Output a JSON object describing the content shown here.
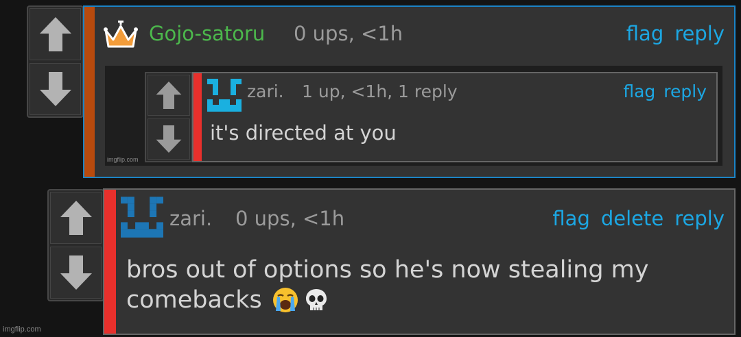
{
  "comment1": {
    "username": "Gojo-satoru",
    "meta": "0 ups, <1h",
    "actions": [
      "flag",
      "reply"
    ],
    "username_color": "#4cb84c",
    "bar_color": "#b84a0d",
    "border_color": "#1b84c6",
    "badge": "crown-icon",
    "image": {
      "username": "zari.",
      "meta": "1 up, <1h, 1 reply",
      "actions": [
        "flag",
        "reply"
      ],
      "text": "it's directed at you",
      "watermark": "imgflip.com",
      "avatar": "pixel-face-avatar"
    }
  },
  "comment2": {
    "username": "zari.",
    "meta": "0 ups, <1h",
    "actions": [
      "flag",
      "delete",
      "reply"
    ],
    "text_line1": "bros out of options so he's now stealing my",
    "text_line2": "comebacks",
    "emojis": [
      "loudly-crying-face",
      "skull"
    ],
    "bar_color": "#e8302c",
    "avatar": "pixel-face-avatar"
  },
  "watermark": "imgflip.com",
  "accent_color": "#1ca7e3"
}
